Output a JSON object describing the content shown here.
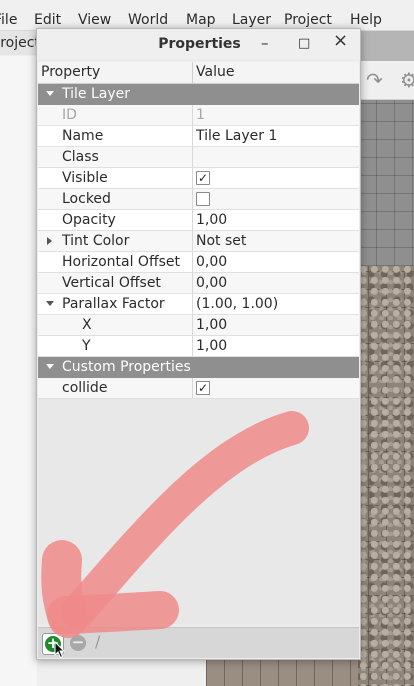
{
  "menubar": {
    "items": [
      "File",
      "Edit",
      "View",
      "World",
      "Map",
      "Layer",
      "Project",
      "Help"
    ]
  },
  "project_tab": {
    "label": "Project"
  },
  "dialog": {
    "title": "Properties",
    "minimize": "–",
    "maximize": "□",
    "close": "×",
    "headers": {
      "property": "Property",
      "value": "Value"
    },
    "groups": {
      "tile_layer": "Tile Layer",
      "custom_properties": "Custom Properties"
    },
    "rows": {
      "id": {
        "name": "ID",
        "value": "1"
      },
      "name": {
        "name": "Name",
        "value": "Tile Layer 1"
      },
      "class": {
        "name": "Class",
        "value": ""
      },
      "visible": {
        "name": "Visible",
        "checked": true
      },
      "locked": {
        "name": "Locked",
        "checked": false
      },
      "opacity": {
        "name": "Opacity",
        "value": "1,00"
      },
      "tint_color": {
        "name": "Tint Color",
        "value": "Not set"
      },
      "horizontal_offset": {
        "name": "Horizontal Offset",
        "value": "0,00"
      },
      "vertical_offset": {
        "name": "Vertical Offset",
        "value": "0,00"
      },
      "parallax_factor": {
        "name": "Parallax Factor",
        "value": "(1.00, 1.00)"
      },
      "parallax_x": {
        "name": "X",
        "value": "1,00"
      },
      "parallax_y": {
        "name": "Y",
        "value": "1,00"
      },
      "collide": {
        "name": "collide",
        "checked": true
      }
    },
    "check_mark": "✓",
    "add_symbol": "+",
    "remove_symbol": "−",
    "rename_symbol": "∕"
  },
  "toolbar_icons": [
    "redo-icon",
    "gear-icon"
  ],
  "colors": {
    "group_header": "#8f8f8f",
    "add_button": "#1c8a2d",
    "annotation_arrow": "#f08a8a"
  }
}
